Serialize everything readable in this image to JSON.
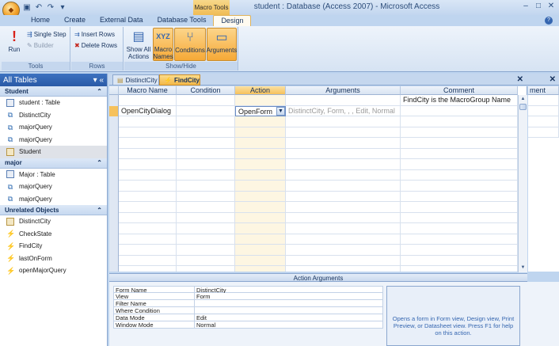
{
  "window": {
    "title": "student : Database (Access 2007) - Microsoft Access",
    "context_tab_title": "Macro Tools",
    "qat_icons": [
      "save-icon",
      "undo-icon",
      "redo-icon",
      "customize-icon"
    ]
  },
  "ribbon_tabs": [
    "Home",
    "Create",
    "External Data",
    "Database Tools",
    "Design"
  ],
  "active_tab": "Design",
  "ribbon": {
    "tools": {
      "label": "Tools",
      "run": "Run",
      "single_step": "Single Step",
      "builder": "Builder"
    },
    "rows": {
      "label": "Rows",
      "insert_rows": "Insert Rows",
      "delete_rows": "Delete Rows"
    },
    "show_hide": {
      "label": "Show/Hide",
      "show_all_actions": "Show All Actions",
      "macro_names": "Macro Names",
      "conditions": "Conditions",
      "arguments": "Arguments"
    }
  },
  "nav": {
    "header": "All Tables",
    "groups": [
      {
        "name": "Student",
        "items": [
          {
            "label": "student : Table",
            "icon": "table-icon"
          },
          {
            "label": "DistinctCity",
            "icon": "query-icon"
          },
          {
            "label": "majorQuery",
            "icon": "query-icon"
          },
          {
            "label": "majorQuery",
            "icon": "query-icon"
          },
          {
            "label": "Student",
            "icon": "form-icon"
          }
        ]
      },
      {
        "name": "major",
        "items": [
          {
            "label": "Major : Table",
            "icon": "table-icon"
          },
          {
            "label": "majorQuery",
            "icon": "query-icon"
          },
          {
            "label": "majorQuery",
            "icon": "query-icon"
          }
        ]
      },
      {
        "name": "Unrelated Objects",
        "items": [
          {
            "label": "DistinctCity",
            "icon": "form-icon"
          },
          {
            "label": "CheckState",
            "icon": "macro-icon"
          },
          {
            "label": "FindCity",
            "icon": "macro-icon"
          },
          {
            "label": "lastOnForm",
            "icon": "macro-icon"
          },
          {
            "label": "openMajorQuery",
            "icon": "macro-icon"
          }
        ]
      }
    ]
  },
  "doc_tabs": [
    "DistinctCity",
    "FindCity"
  ],
  "grid": {
    "columns": [
      "Macro Name",
      "Condition",
      "Action",
      "Arguments",
      "Comment"
    ],
    "rows": [
      {
        "macro_name": "",
        "condition": "",
        "action": "",
        "arguments": "",
        "comment": "FindCity is the MacroGroup Name"
      },
      {
        "macro_name": "OpenCityDialog",
        "condition": "",
        "action": "OpenForm",
        "arguments": "DistinctCity, Form, , , Edit, Normal",
        "comment": ""
      }
    ],
    "background_column_fragment": "ment"
  },
  "action_arguments": {
    "title": "Action Arguments",
    "properties": [
      {
        "name": "Form Name",
        "value": "DistinctCity"
      },
      {
        "name": "View",
        "value": "Form"
      },
      {
        "name": "Filter Name",
        "value": ""
      },
      {
        "name": "Where Condition",
        "value": ""
      },
      {
        "name": "Data Mode",
        "value": "Edit"
      },
      {
        "name": "Window Mode",
        "value": "Normal"
      }
    ],
    "help": "Opens a form in Form view, Design view, Print Preview, or Datasheet view. Press F1 for help on this action."
  },
  "colors": {
    "accent": "#f6c15c",
    "nav_header": "#2a5aa6",
    "ribbon_bg": "#d6e3f3"
  }
}
